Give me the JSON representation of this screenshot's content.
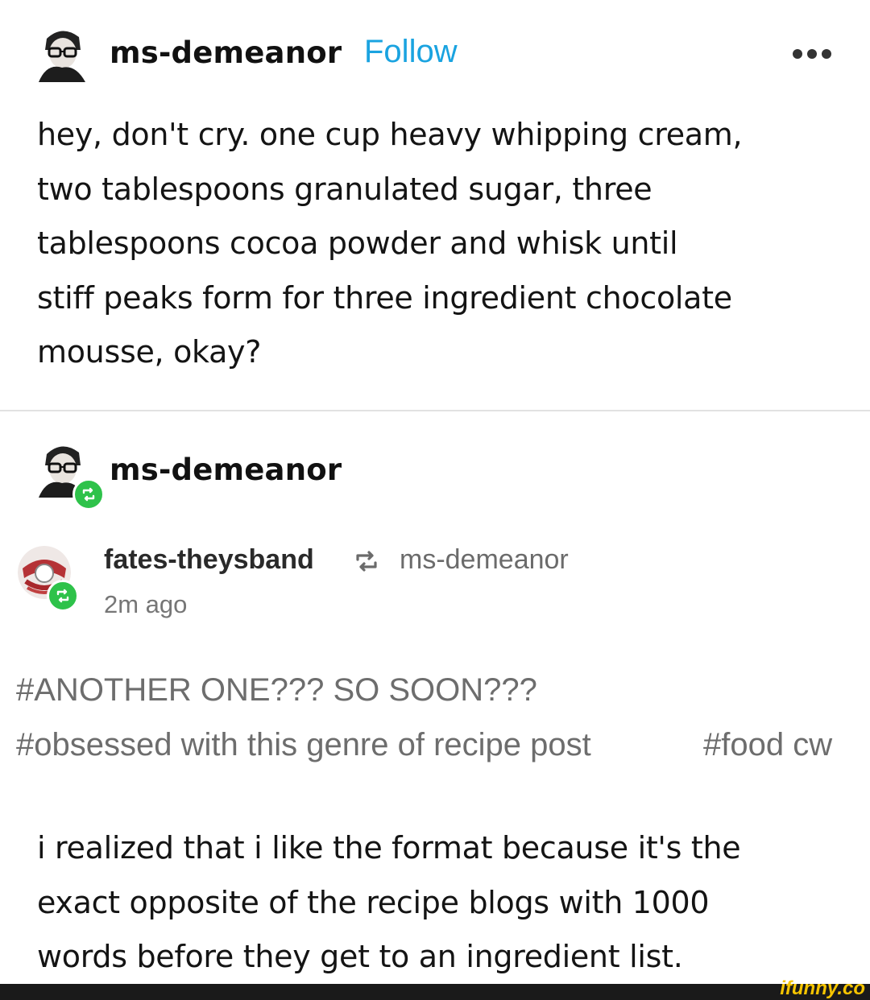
{
  "post": {
    "author": "ms-demeanor",
    "follow_label": "Follow",
    "more_icon": "more-horizontal-icon",
    "body_lines": [
      "hey, don't cry. one cup heavy whipping cream,",
      "two tablespoons granulated sugar, three",
      "tablespoons cocoa powder and whisk until",
      "stiff peaks form for three ingredient chocolate",
      "mousse, okay?"
    ]
  },
  "reblog_header": {
    "author": "ms-demeanor",
    "badge_icon": "reblog-icon"
  },
  "reblog": {
    "user": "fates-theysband",
    "source": "ms-demeanor",
    "time": "2m ago",
    "tags": [
      "#ANOTHER ONE??? SO SOON???",
      "#obsessed with this genre of recipe post",
      "#food cw"
    ],
    "body_lines": [
      "i realized that i like the format because it's the",
      "exact opposite of the recipe blogs with 1000",
      "words before they get to an ingredient list."
    ]
  },
  "watermark": "ifunny.co",
  "colors": {
    "follow": "#1aa3e0",
    "reblog_green": "#2ec24a",
    "tag_gray": "#6d6d6d",
    "watermark_yellow": "#f5c400"
  }
}
